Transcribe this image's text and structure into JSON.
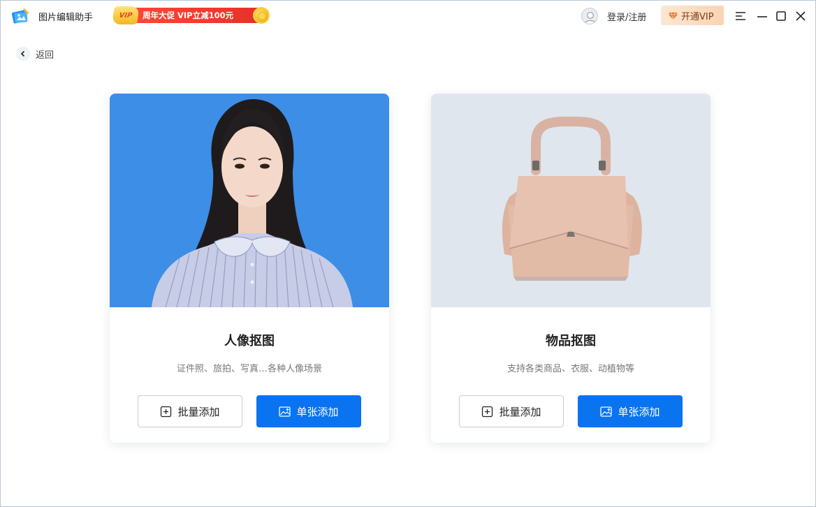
{
  "app": {
    "title": "图片编辑助手",
    "promo_badge": "VIP",
    "promo_text": "周年大促 VIP立减100元",
    "login_label": "登录/注册",
    "vip_button_label": "开通VIP"
  },
  "nav": {
    "back_label": "返回"
  },
  "cards": [
    {
      "title": "人像抠图",
      "subtitle": "证件照、旅拍、写真…各种人像场景",
      "batch_label": "批量添加",
      "single_label": "单张添加"
    },
    {
      "title": "物品抠图",
      "subtitle": "支持各类商品、衣服、动植物等",
      "batch_label": "批量添加",
      "single_label": "单张添加"
    }
  ],
  "colors": {
    "primary": "#0a73f0",
    "portrait_bg": "#3d8ee6",
    "product_bg": "#dfe6ee",
    "promo_red": "#f0382d"
  }
}
